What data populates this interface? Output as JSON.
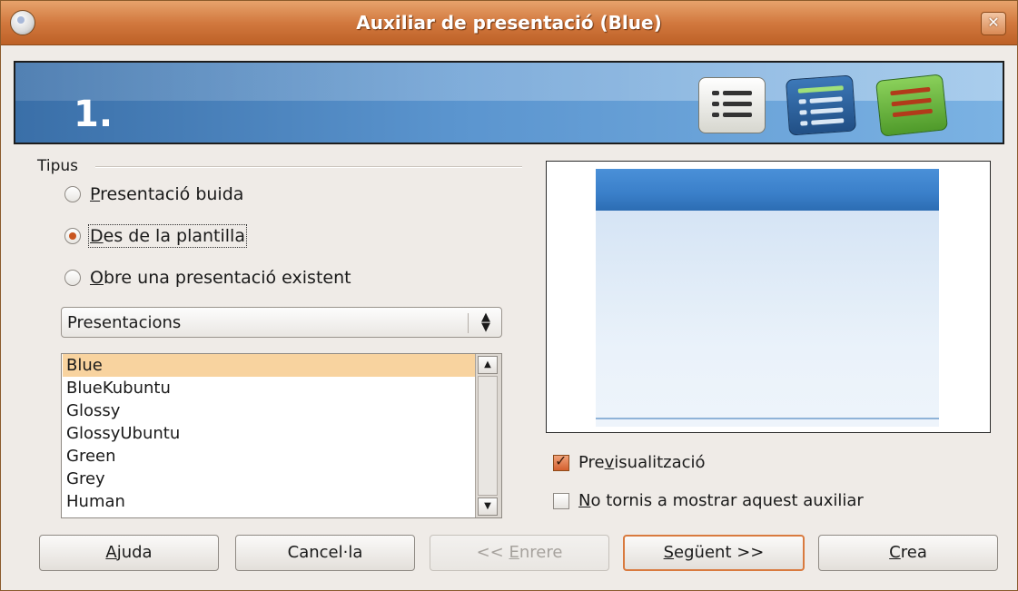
{
  "window": {
    "title": "Auxiliar de presentació (Blue)",
    "close_glyph": "✕"
  },
  "banner": {
    "step": "1.",
    "icons": [
      "list-icon",
      "list-highlight-icon",
      "list-green-icon"
    ]
  },
  "type_group": {
    "label": "Tipus",
    "options": [
      {
        "label": "Presentació buida",
        "mnemonic": "P",
        "rest": "resentació buida",
        "selected": false
      },
      {
        "label": "Des de la plantilla",
        "mnemonic": "D",
        "rest": "es de la plantilla",
        "selected": true
      },
      {
        "label": "Obre una presentació existent",
        "mnemonic": "O",
        "rest": "bre una presentació existent",
        "selected": false
      }
    ]
  },
  "category_combo": {
    "value": "Presentacions"
  },
  "template_list": {
    "items": [
      "Blue",
      "BlueKubuntu",
      "Glossy",
      "GlossyUbuntu",
      "Green",
      "Grey",
      "Human"
    ],
    "selected": "Blue"
  },
  "checkboxes": {
    "preview": {
      "pre": "Pre",
      "mnemonic": "v",
      "post": "isualització",
      "checked": true
    },
    "dont_show": {
      "pre": "",
      "mnemonic": "N",
      "post": "o tornis a mostrar aquest auxiliar",
      "checked": false
    }
  },
  "buttons": {
    "help": {
      "mnemonic": "A",
      "rest": "juda"
    },
    "cancel": {
      "label": "Cancel·la"
    },
    "back": {
      "pre": "<< ",
      "mnemonic": "E",
      "rest": "nrere"
    },
    "next": {
      "mnemonic": "S",
      "rest": "egüent >>"
    },
    "create": {
      "mnemonic": "C",
      "rest": "rea"
    }
  },
  "colors": {
    "titlebar": "#d2793f",
    "accent": "#d97a3e",
    "selection": "#f8d39f",
    "banner_blue": "#5b95cf"
  }
}
